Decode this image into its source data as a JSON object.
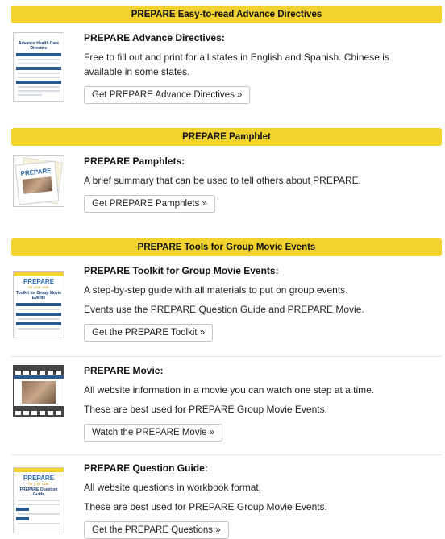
{
  "sections": [
    {
      "header": "PREPARE Easy-to-read Advance Directives",
      "items": [
        {
          "title": "PREPARE Advance Directives:",
          "descriptions": [
            "Free to fill out and print for all states in English and Spanish. Chinese is available in some states."
          ],
          "button": "Get PREPARE Advance Directives »",
          "thumb_icon": "advance-directive-document-icon"
        }
      ]
    },
    {
      "header": "PREPARE Pamphlet",
      "items": [
        {
          "title": "PREPARE Pamphlets:",
          "descriptions": [
            "A brief summary that can be used to tell others about PREPARE."
          ],
          "button": "Get PREPARE Pamphlets »",
          "thumb_icon": "pamphlet-icon"
        }
      ]
    },
    {
      "header": "PREPARE Tools for Group Movie Events",
      "items": [
        {
          "title": "PREPARE Toolkit for Group Movie Events:",
          "descriptions": [
            "A step-by-step guide with all materials to put on group events.",
            "Events use the PREPARE Question Guide and PREPARE Movie."
          ],
          "button": "Get the PREPARE Toolkit »",
          "thumb_icon": "toolkit-document-icon"
        },
        {
          "title": "PREPARE Movie:",
          "descriptions": [
            "All website information in a movie you can watch one step at a time.",
            "These are best used for PREPARE Group Movie Events."
          ],
          "button": "Watch the PREPARE Movie »",
          "thumb_icon": "film-strip-icon"
        },
        {
          "title": "PREPARE Question Guide:",
          "descriptions": [
            "All website questions in workbook format.",
            "These are best used for PREPARE Group Movie Events."
          ],
          "button": "Get the PREPARE Questions »",
          "thumb_icon": "question-guide-document-icon"
        }
      ]
    }
  ],
  "thumb_text": {
    "ad_title": "Advance Health Care Directive",
    "prepare_logo": "PREPARE",
    "for_your_care": "for your care",
    "toolkit_title": "Toolkit for Group Movie Events",
    "question_title": "PREPARE Question Guide"
  },
  "colors": {
    "header_bg": "#f2d22e",
    "border": "#c6c6c6"
  }
}
